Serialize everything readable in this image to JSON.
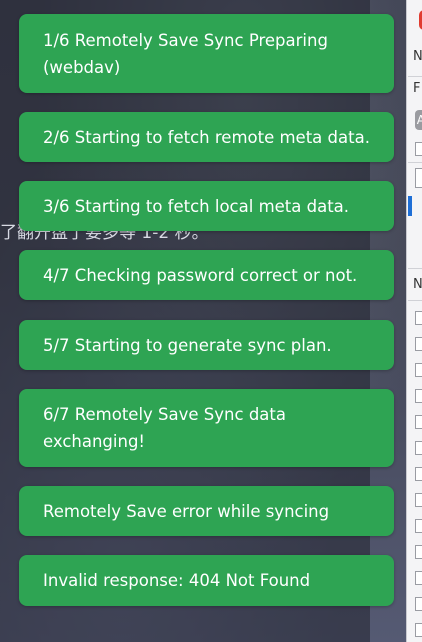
{
  "background": {
    "partial_text": "了翻开盘了要多等 1-2 秒。"
  },
  "side_panel": {
    "items": [
      "N",
      "F",
      "A",
      "N"
    ]
  },
  "notifications": [
    {
      "text": "1/6 Remotely Save Sync Preparing (webdav)"
    },
    {
      "text": "2/6 Starting to fetch remote meta data."
    },
    {
      "text": "3/6 Starting to fetch local meta data."
    },
    {
      "text": "4/7 Checking password correct or not."
    },
    {
      "text": "5/7 Starting to generate sync plan."
    },
    {
      "text": "6/7 Remotely Save Sync data exchanging!"
    },
    {
      "text": "Remotely Save error while syncing"
    },
    {
      "text": "Invalid response: 404 Not Found"
    }
  ],
  "colors": {
    "toast_background": "#2ea453",
    "toast_text": "#ffffff"
  }
}
